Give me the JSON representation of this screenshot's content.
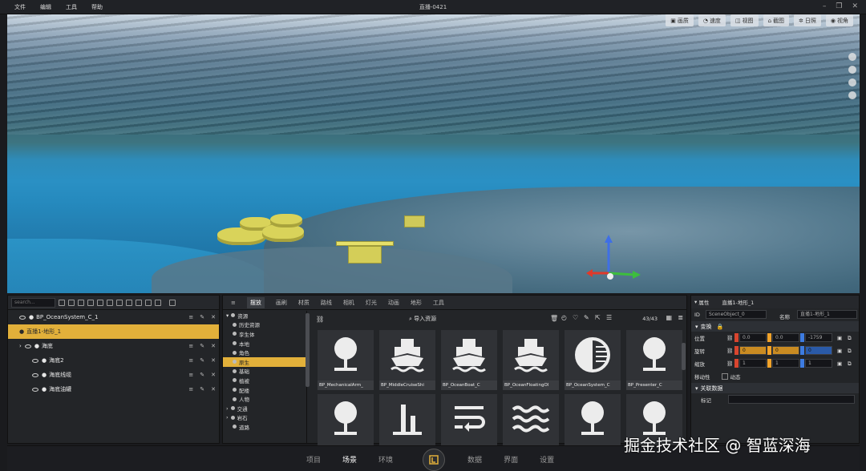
{
  "window": {
    "title": "直播-0421"
  },
  "menu": {
    "file": "文件",
    "edit": "编辑",
    "tools": "工具",
    "help": "帮助"
  },
  "viewport": {
    "buttons": [
      {
        "icon": "image-icon",
        "label": "画质"
      },
      {
        "icon": "speed-icon",
        "label": "速度"
      },
      {
        "icon": "view-icon",
        "label": "视图"
      },
      {
        "icon": "screenshot-icon",
        "label": "截图"
      },
      {
        "icon": "sun-icon",
        "label": "日照"
      },
      {
        "icon": "eye-icon",
        "label": "视角"
      }
    ]
  },
  "outliner": {
    "search_placeholder": "search...",
    "items": [
      {
        "name": "BP_OceanSystem_C_1",
        "indent": 0
      },
      {
        "name": "直播1-地形_1",
        "indent": 0,
        "selected": true
      },
      {
        "name": "海底",
        "indent": 1
      },
      {
        "name": "海底2",
        "indent": 2
      },
      {
        "name": "海底线缆",
        "indent": 2
      },
      {
        "name": "海底油罐",
        "indent": 2
      }
    ]
  },
  "assets_panel": {
    "tabs": [
      "摆放",
      "画刷",
      "材质",
      "路线",
      "相机",
      "灯光",
      "动画",
      "地形",
      "工具"
    ],
    "categories": [
      {
        "label": "资源",
        "expand": true
      },
      {
        "label": "历史资源"
      },
      {
        "label": "孪生体"
      },
      {
        "label": "本地"
      },
      {
        "label": "角色"
      },
      {
        "label": "原生",
        "selected": true
      },
      {
        "label": "基础"
      },
      {
        "label": "植被"
      },
      {
        "label": "配楼"
      },
      {
        "label": "人物"
      },
      {
        "label": "交通",
        "arrow": true
      },
      {
        "label": "岩石",
        "arrow": true
      },
      {
        "label": "道路"
      }
    ],
    "import_label": "导入资源",
    "count": "43/43",
    "tiles": [
      {
        "label": "BP_MechanicalArm_",
        "icon": "pin-icon"
      },
      {
        "label": "BP_MiddleCruiseShi",
        "icon": "ship-icon"
      },
      {
        "label": "BP_OceanBoat_C",
        "icon": "ship-icon"
      },
      {
        "label": "BP_OceanFloatingOl",
        "icon": "ship-icon"
      },
      {
        "label": "BP_OceanSystem_C",
        "icon": "ocean-icon"
      },
      {
        "label": "BP_Presenter_C",
        "icon": "pin-icon"
      },
      {
        "label": "",
        "icon": "pin-icon"
      },
      {
        "label": "",
        "icon": "bars-icon"
      },
      {
        "label": "",
        "icon": "wrap-icon"
      },
      {
        "label": "",
        "icon": "waves-icon"
      },
      {
        "label": "",
        "icon": "pin-icon"
      },
      {
        "label": "",
        "icon": "pin-icon"
      }
    ]
  },
  "properties": {
    "title": "属性",
    "object_name": "直播1-地形_1",
    "id_label": "ID",
    "id_value": "SceneObject_0",
    "name_label": "名称",
    "name_value": "直播1-地形_1",
    "transform_label": "变换",
    "position_label": "位置",
    "rotation_label": "旋转",
    "scale_label": "缩放",
    "mobility_label": "移动性",
    "mobility_value": "动态",
    "position": {
      "x": "0.0",
      "y": "0.0",
      "z": "-1759"
    },
    "rotation": {
      "x": "0",
      "y": "0",
      "z": "0"
    },
    "scale": {
      "x": "1",
      "y": "1",
      "z": "1"
    },
    "related_label": "关联数据",
    "tag_label": "标记"
  },
  "bottom_tabs": [
    {
      "label": "项目"
    },
    {
      "label": "场景",
      "active": true
    },
    {
      "label": "环境"
    },
    {
      "label": "数据"
    },
    {
      "label": "界面"
    },
    {
      "label": "设置"
    }
  ],
  "watermark": "掘金技术社区 @ 智蓝深海"
}
